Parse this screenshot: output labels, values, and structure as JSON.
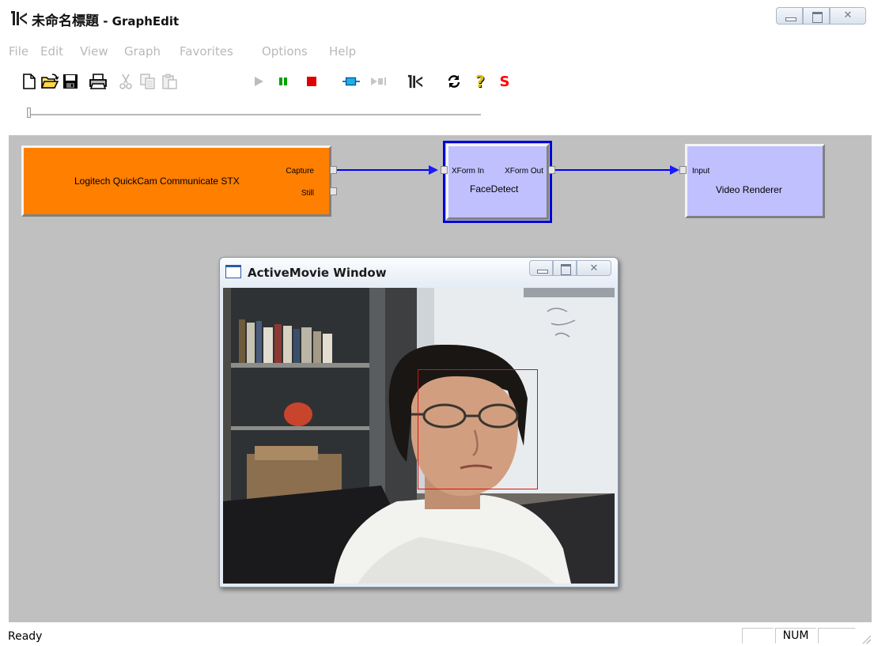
{
  "window": {
    "title_main": "未命名標題",
    "title_sub": " - GraphEdit"
  },
  "menu": {
    "items": [
      "File",
      "Edit",
      "View",
      "Graph",
      "Favorites",
      "Options",
      "Help"
    ]
  },
  "toolbar": {
    "buttons": [
      {
        "name": "new-icon"
      },
      {
        "name": "open-folder-icon"
      },
      {
        "name": "save-icon"
      },
      {
        "name": "print-icon"
      },
      {
        "name": "cut-icon"
      },
      {
        "name": "copy-icon"
      },
      {
        "name": "paste-icon"
      },
      {
        "name": "play-icon"
      },
      {
        "name": "pause-icon"
      },
      {
        "name": "stop-icon"
      },
      {
        "name": "seek-icon"
      },
      {
        "name": "frame-step-icon"
      },
      {
        "name": "graphedit-icon"
      },
      {
        "name": "refresh-icon"
      },
      {
        "name": "help-icon"
      },
      {
        "name": "s-icon"
      }
    ],
    "s_label": "S",
    "help_label": "?"
  },
  "seek": {
    "position": 0.0
  },
  "graph": {
    "filters": [
      {
        "id": "capture-filter",
        "name": "Logitech QuickCam Communicate STX",
        "output_pins": [
          "Capture",
          "Still"
        ],
        "color": "#ff7f00"
      },
      {
        "id": "facedetect-filter",
        "name": "FaceDetect",
        "input_pins": [
          "XForm In"
        ],
        "output_pins": [
          "XForm Out"
        ],
        "color": "#c0c0ff",
        "selected": true
      },
      {
        "id": "renderer-filter",
        "name": "Video Renderer",
        "input_pins": [
          "Input"
        ],
        "color": "#c0c0ff"
      }
    ],
    "wire_color": "#0000ff"
  },
  "activemovie": {
    "title": "ActiveMovie Window",
    "face_box_color": "#e01010"
  },
  "status": {
    "text": "Ready",
    "num": "NUM"
  }
}
